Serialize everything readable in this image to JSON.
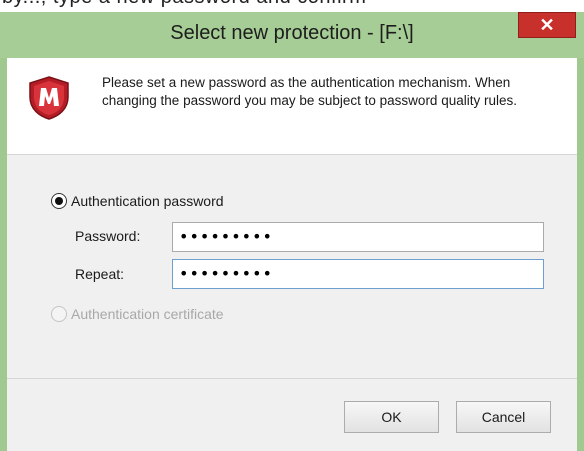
{
  "background": {
    "clipped_text": "by..., type a new password and confirm"
  },
  "dialog": {
    "title": "Select new protection - [F:\\]",
    "close_symbol": "✕",
    "icon": "mcafee-shield-icon",
    "instructions": "Please set a new password as the authentication mechanism. When changing the password you may be subject to password quality rules."
  },
  "options": {
    "password_option": {
      "label": "Authentication password",
      "selected": true
    },
    "certificate_option": {
      "label": "Authentication certificate",
      "selected": false,
      "disabled": true
    }
  },
  "fields": {
    "password": {
      "label": "Password:",
      "value": "•••••••••"
    },
    "repeat": {
      "label": "Repeat:",
      "value": "•••••••••"
    }
  },
  "buttons": {
    "ok": "OK",
    "cancel": "Cancel"
  },
  "colors": {
    "frame": "#a6cd95",
    "close": "#c7302b",
    "shield": "#c0202a"
  }
}
